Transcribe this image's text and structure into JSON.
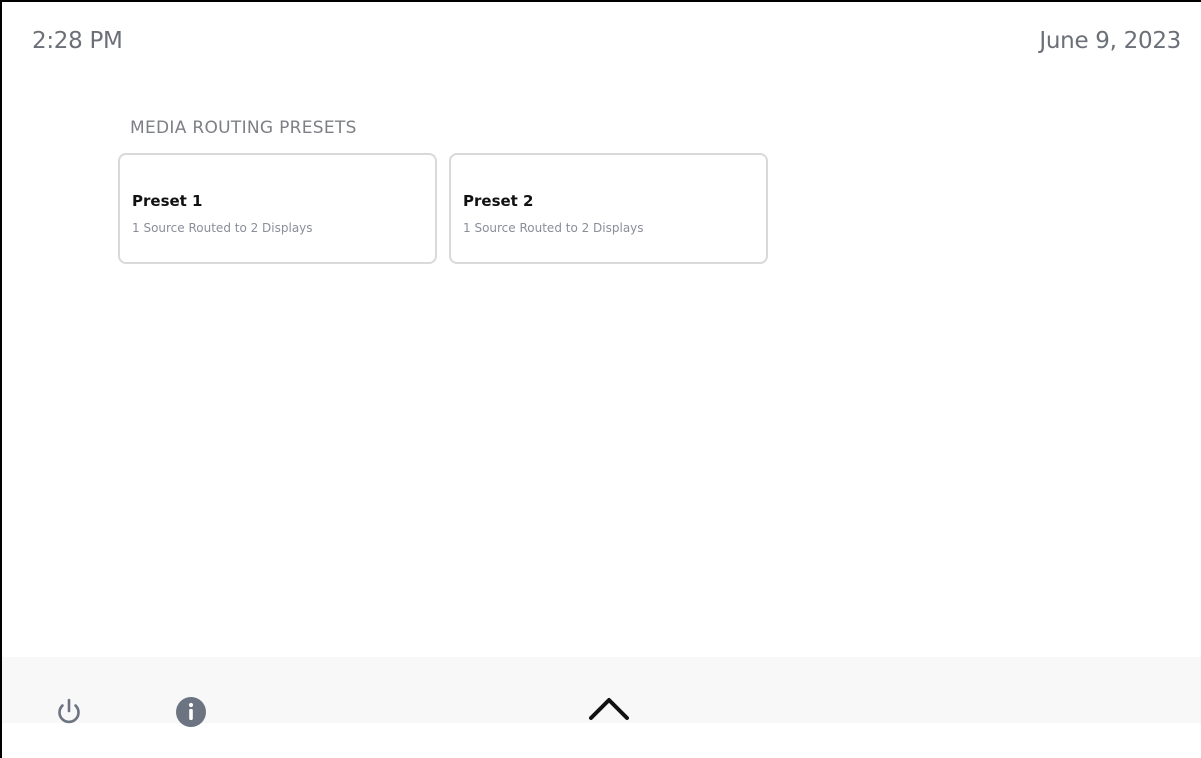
{
  "status": {
    "time": "2:28 PM",
    "date": "June 9, 2023"
  },
  "section": {
    "title": "MEDIA ROUTING PRESETS"
  },
  "presets": [
    {
      "name": "Preset 1",
      "description": "1 Source Routed to 2 Displays"
    },
    {
      "name": "Preset 2",
      "description": "1 Source Routed to 2 Displays"
    }
  ],
  "bottom_bar": {
    "icons": [
      "power-icon",
      "info-icon",
      "chevron-up-icon"
    ]
  },
  "colors": {
    "text_muted": "#6b6f78",
    "card_border": "#d9d9dc",
    "icon_gray": "#6c7482",
    "bar_background": "#f8f8f9"
  }
}
